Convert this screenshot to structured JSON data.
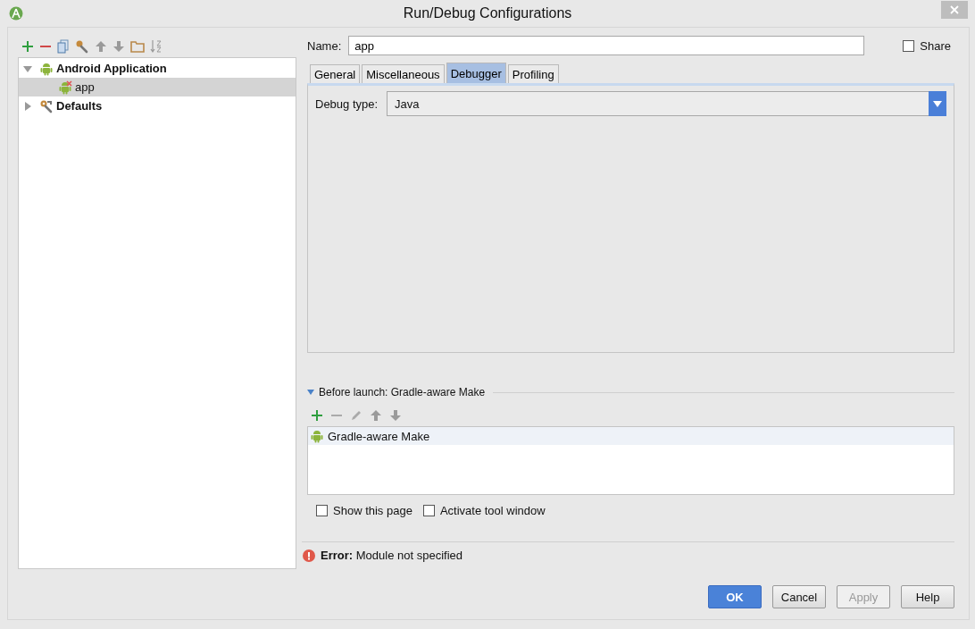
{
  "window": {
    "title": "Run/Debug Configurations"
  },
  "tree": [
    {
      "label": "Android Application",
      "kind": "android",
      "selected": false,
      "expanded": true,
      "children": [
        {
          "label": "app",
          "kind": "android_error",
          "selected": true
        }
      ]
    },
    {
      "label": "Defaults",
      "kind": "defaults",
      "selected": false,
      "expanded": false
    }
  ],
  "name_field": {
    "label": "Name:",
    "value": "app"
  },
  "share": {
    "label": "Share",
    "checked": false
  },
  "tabs": [
    {
      "label": "General",
      "selected": false
    },
    {
      "label": "Miscellaneous",
      "selected": false
    },
    {
      "label": "Debugger",
      "selected": true
    },
    {
      "label": "Profiling",
      "selected": false
    }
  ],
  "debug_type": {
    "label": "Debug type:",
    "value": "Java"
  },
  "before_launch": {
    "title": "Before launch: Gradle-aware Make",
    "expanded": true,
    "tasks": [
      {
        "label": "Gradle-aware Make",
        "selected": true
      }
    ]
  },
  "options": [
    {
      "label": "Show this page",
      "checked": false
    },
    {
      "label": "Activate tool window",
      "checked": false
    }
  ],
  "error": "**Error:** Module not specified",
  "buttons": [
    {
      "label": "OK",
      "kind": "primary",
      "disabled": false
    },
    {
      "label": "Cancel",
      "kind": "normal",
      "disabled": false
    },
    {
      "label": "Apply",
      "kind": "normal",
      "disabled": true
    },
    {
      "label": "Help",
      "kind": "normal",
      "disabled": false
    }
  ]
}
